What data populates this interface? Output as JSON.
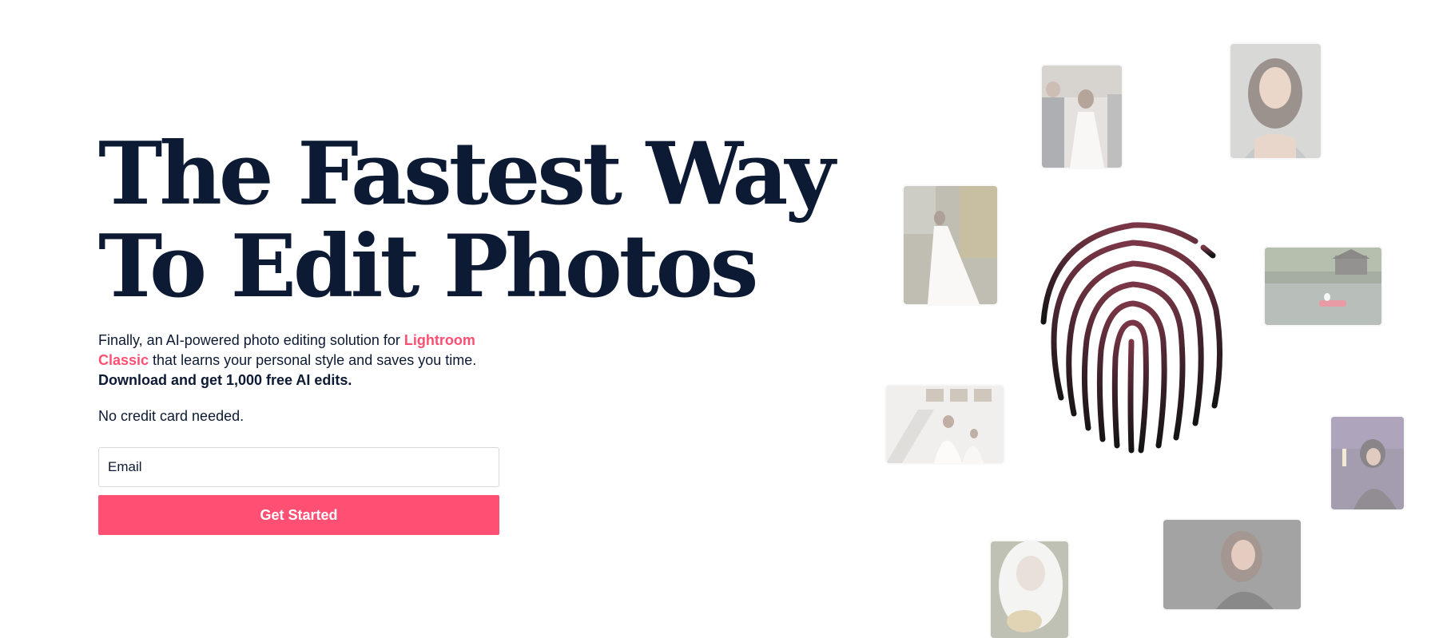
{
  "hero": {
    "headline_line1": "The Fastest Way",
    "headline_line2": "To Edit Photos",
    "subtext_prefix": "Finally, an AI-powered photo editing solution for ",
    "subtext_accent": "Lightroom Classic",
    "subtext_suffix": " that learns your personal style and saves you time.",
    "subtext_bold": "Download and get 1,000 free AI edits.",
    "no_credit_card": "No credit card needed."
  },
  "signup": {
    "email_placeholder": "Email",
    "cta_label": "Get Started"
  },
  "colors": {
    "accent": "#ff4f72",
    "navy": "#0c1a33"
  },
  "gallery": {
    "icon": "fingerprint-icon",
    "photos": [
      "wedding-ceremony",
      "bride-portrait",
      "bride-garden",
      "lake-cabin",
      "bride-staircase",
      "woman-toast",
      "bride-veil",
      "woman-smiling"
    ]
  }
}
